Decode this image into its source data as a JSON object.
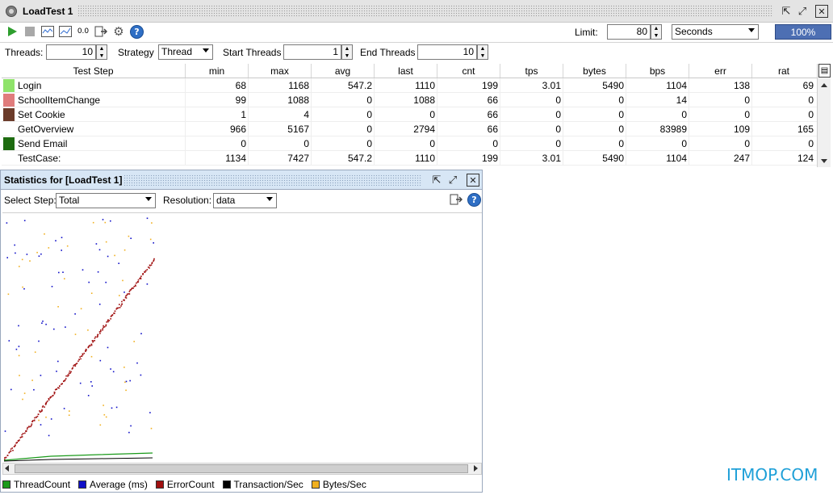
{
  "window": {
    "title": "LoadTest 1"
  },
  "toolbar": {
    "limit_label": "Limit:",
    "limit_value": "80",
    "limit_unit": "Seconds",
    "progress": "100%",
    "progress_value": 100,
    "counter_label": "0.0"
  },
  "config": {
    "threads_label": "Threads:",
    "threads_value": "10",
    "strategy_label": "Strategy",
    "strategy_value": "Thread",
    "start_threads_label": "Start Threads",
    "start_threads_value": "1",
    "end_threads_label": "End Threads",
    "end_threads_value": "10"
  },
  "table": {
    "columns": [
      "Test Step",
      "min",
      "max",
      "avg",
      "last",
      "cnt",
      "tps",
      "bytes",
      "bps",
      "err",
      "rat"
    ],
    "rows": [
      {
        "name": "Login",
        "color": "#8fe36a",
        "values": [
          "68",
          "1168",
          "547.2",
          "1110",
          "199",
          "3.01",
          "5490",
          "1104",
          "138",
          "69"
        ]
      },
      {
        "name": "SchoolItemChange",
        "color": "#e07c7c",
        "values": [
          "99",
          "1088",
          "0",
          "1088",
          "66",
          "0",
          "0",
          "14",
          "0",
          "0"
        ]
      },
      {
        "name": "Set Cookie",
        "color": "#6b3b2a",
        "values": [
          "1",
          "4",
          "0",
          "0",
          "66",
          "0",
          "0",
          "0",
          "0",
          "0"
        ]
      },
      {
        "name": "GetOverview",
        "color": "",
        "values": [
          "966",
          "5167",
          "0",
          "2794",
          "66",
          "0",
          "0",
          "83989",
          "109",
          "165"
        ]
      },
      {
        "name": "Send Email",
        "color": "#1d6b10",
        "values": [
          "0",
          "0",
          "0",
          "0",
          "0",
          "0",
          "0",
          "0",
          "0",
          "0"
        ]
      },
      {
        "name": "TestCase:",
        "color": "",
        "values": [
          "1134",
          "7427",
          "547.2",
          "1110",
          "199",
          "3.01",
          "5490",
          "1104",
          "247",
          "124"
        ]
      }
    ]
  },
  "stats": {
    "title": "Statistics for [LoadTest 1]",
    "select_step_label": "Select Step:",
    "select_step_value": "Total",
    "resolution_label": "Resolution:",
    "resolution_value": "data"
  },
  "legend": [
    {
      "label": "ThreadCount",
      "color": "#1a9a1a"
    },
    {
      "label": "Average (ms)",
      "color": "#1010c8"
    },
    {
      "label": "ErrorCount",
      "color": "#a01010"
    },
    {
      "label": "Transaction/Sec",
      "color": "#000000"
    },
    {
      "label": "Bytes/Sec",
      "color": "#f0b020"
    }
  ],
  "watermark": "ITMOP.COM"
}
